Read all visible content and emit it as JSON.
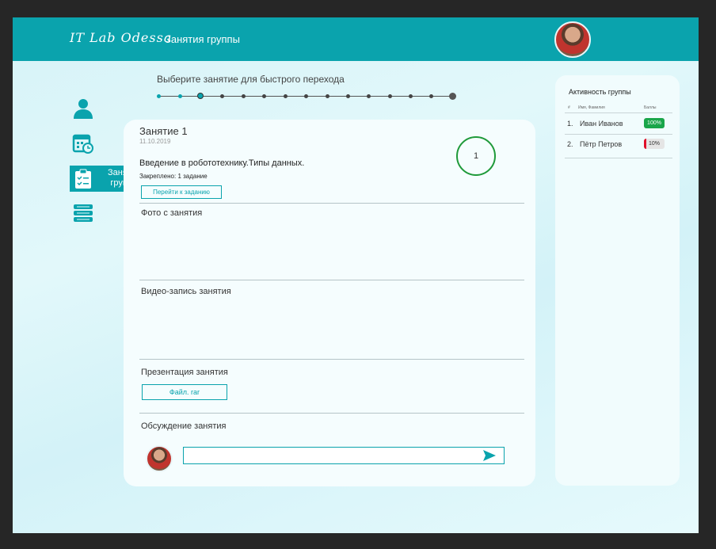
{
  "header": {
    "logo": "IT Lab Odessa",
    "title": "Занятия группы"
  },
  "sidebar": {
    "active_label": "Занятия группы",
    "icons": [
      "user-icon",
      "calendar-clock-icon",
      "clipboard-checklist-icon",
      "books-icon"
    ]
  },
  "stepper": {
    "label": "Выберите занятие для быстрого перехода",
    "current_step": "1",
    "last_step": "15",
    "steps_total": 15
  },
  "lesson": {
    "title": "Занятие 1",
    "date": "11.10.2019",
    "number": "1",
    "topic": "Введение в робототехнику.Типы данных.",
    "attached": "Закреплено: 1 задание",
    "goto_label": "Перейти к заданию",
    "photo_title": "Фото с занятия",
    "video_title": "Видео-запись занятия",
    "presentation_title": "Презентация занятия",
    "file_label": "Файл. rar",
    "discussion_title": "Обсуждение занятия",
    "comment_value": ""
  },
  "activity": {
    "title": "Активность группы",
    "columns": {
      "num": "#",
      "name": "Имя, Фамилия",
      "score": "Баллы"
    },
    "rows": [
      {
        "num": "1.",
        "name": "Иван Иванов",
        "score": "100%",
        "value": 1.0,
        "color": "#1aa64a"
      },
      {
        "num": "2.",
        "name": "Пётр Петров",
        "score": "10%",
        "value": 0.1,
        "color": "#e0102a"
      }
    ]
  },
  "colors": {
    "accent": "#0aa3ad",
    "lesson_circle": "#1f9a3a"
  }
}
